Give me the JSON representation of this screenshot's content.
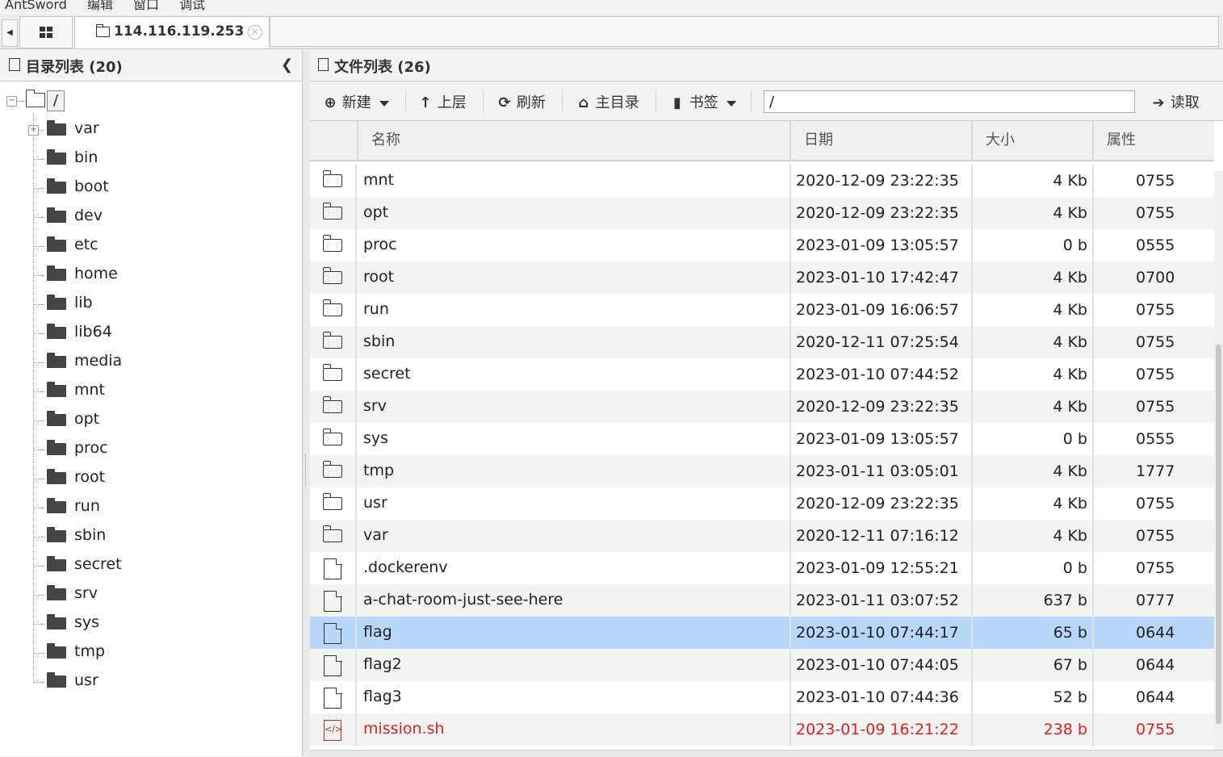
{
  "menu": [
    "AntSword",
    "编辑",
    "窗口",
    "调试"
  ],
  "tabs": {
    "host": "114.116.119.253"
  },
  "left_panel": {
    "title": "目录列表 (20)",
    "root": "/",
    "items": [
      "var",
      "bin",
      "boot",
      "dev",
      "etc",
      "home",
      "lib",
      "lib64",
      "media",
      "mnt",
      "opt",
      "proc",
      "root",
      "run",
      "sbin",
      "secret",
      "srv",
      "sys",
      "tmp",
      "usr"
    ]
  },
  "right_panel": {
    "title": "文件列表 (26)",
    "toolbar": {
      "new": "新建",
      "up": "上层",
      "refresh": "刷新",
      "home": "主目录",
      "bookmark": "书签",
      "path": "/",
      "read": "读取"
    },
    "columns": [
      "名称",
      "日期",
      "大小",
      "属性"
    ],
    "files": [
      {
        "type": "folder",
        "name": "mnt",
        "date": "2020-12-09 23:22:35",
        "size": "4 Kb",
        "attr": "0755"
      },
      {
        "type": "folder",
        "name": "opt",
        "date": "2020-12-09 23:22:35",
        "size": "4 Kb",
        "attr": "0755"
      },
      {
        "type": "folder",
        "name": "proc",
        "date": "2023-01-09 13:05:57",
        "size": "0 b",
        "attr": "0555"
      },
      {
        "type": "folder",
        "name": "root",
        "date": "2023-01-10 17:42:47",
        "size": "4 Kb",
        "attr": "0700"
      },
      {
        "type": "folder",
        "name": "run",
        "date": "2023-01-09 16:06:57",
        "size": "4 Kb",
        "attr": "0755"
      },
      {
        "type": "folder",
        "name": "sbin",
        "date": "2020-12-11 07:25:54",
        "size": "4 Kb",
        "attr": "0755"
      },
      {
        "type": "folder",
        "name": "secret",
        "date": "2023-01-10 07:44:52",
        "size": "4 Kb",
        "attr": "0755"
      },
      {
        "type": "folder",
        "name": "srv",
        "date": "2020-12-09 23:22:35",
        "size": "4 Kb",
        "attr": "0755"
      },
      {
        "type": "folder",
        "name": "sys",
        "date": "2023-01-09 13:05:57",
        "size": "0 b",
        "attr": "0555"
      },
      {
        "type": "folder",
        "name": "tmp",
        "date": "2023-01-11 03:05:01",
        "size": "4 Kb",
        "attr": "1777"
      },
      {
        "type": "folder",
        "name": "usr",
        "date": "2020-12-09 23:22:35",
        "size": "4 Kb",
        "attr": "0755"
      },
      {
        "type": "folder",
        "name": "var",
        "date": "2020-12-11 07:16:12",
        "size": "4 Kb",
        "attr": "0755"
      },
      {
        "type": "file",
        "name": ".dockerenv",
        "date": "2023-01-09 12:55:21",
        "size": "0 b",
        "attr": "0755"
      },
      {
        "type": "file",
        "name": "a-chat-room-just-see-here",
        "date": "2023-01-11 03:07:52",
        "size": "637 b",
        "attr": "0777"
      },
      {
        "type": "file",
        "name": "flag",
        "date": "2023-01-10 07:44:17",
        "size": "65 b",
        "attr": "0644",
        "selected": true
      },
      {
        "type": "file",
        "name": "flag2",
        "date": "2023-01-10 07:44:05",
        "size": "67 b",
        "attr": "0644"
      },
      {
        "type": "file",
        "name": "flag3",
        "date": "2023-01-10 07:44:36",
        "size": "52 b",
        "attr": "0644"
      },
      {
        "type": "code",
        "name": "mission.sh",
        "date": "2023-01-09 16:21:22",
        "size": "238 b",
        "attr": "0755",
        "highlight": "#e02020"
      }
    ]
  },
  "colors": {
    "selected_row": "#b8d6f8",
    "executable": "#e02020"
  }
}
